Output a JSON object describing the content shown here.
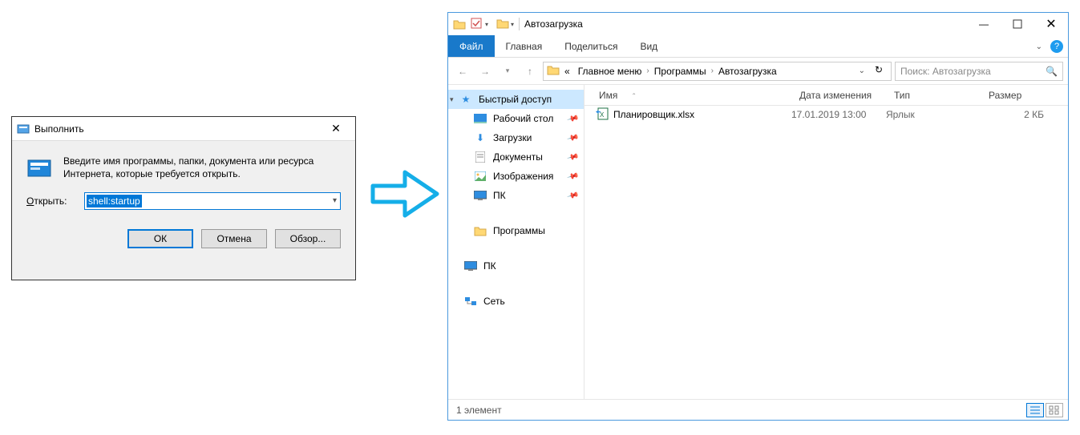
{
  "run_dialog": {
    "title": "Выполнить",
    "prompt": "Введите имя программы, папки, документа или ресурса Интернета, которые требуется открыть.",
    "label": "Открыть:",
    "value": "shell:startup",
    "ok": "ОК",
    "cancel": "Отмена",
    "browse": "Обзор...",
    "close": "✕"
  },
  "explorer": {
    "title": "Автозагрузка",
    "tabs": {
      "file": "Файл",
      "home": "Главная",
      "share": "Поделиться",
      "view": "Вид"
    },
    "breadcrumb": {
      "start": "«",
      "a": "Главное меню",
      "b": "Программы",
      "c": "Автозагрузка"
    },
    "search_placeholder": "Поиск: Автозагрузка",
    "nav": {
      "quick": "Быстрый доступ",
      "desktop": "Рабочий стол",
      "downloads": "Загрузки",
      "documents": "Документы",
      "pictures": "Изображения",
      "pc_q": "ПК",
      "programs": "Программы",
      "pc": "ПК",
      "network": "Сеть"
    },
    "cols": {
      "name": "Имя",
      "date": "Дата изменения",
      "type": "Тип",
      "size": "Размер"
    },
    "row": {
      "name": "Планировщик.xlsx",
      "date": "17.01.2019 13:00",
      "type": "Ярлык",
      "size": "2 КБ"
    },
    "status": "1 элемент"
  }
}
